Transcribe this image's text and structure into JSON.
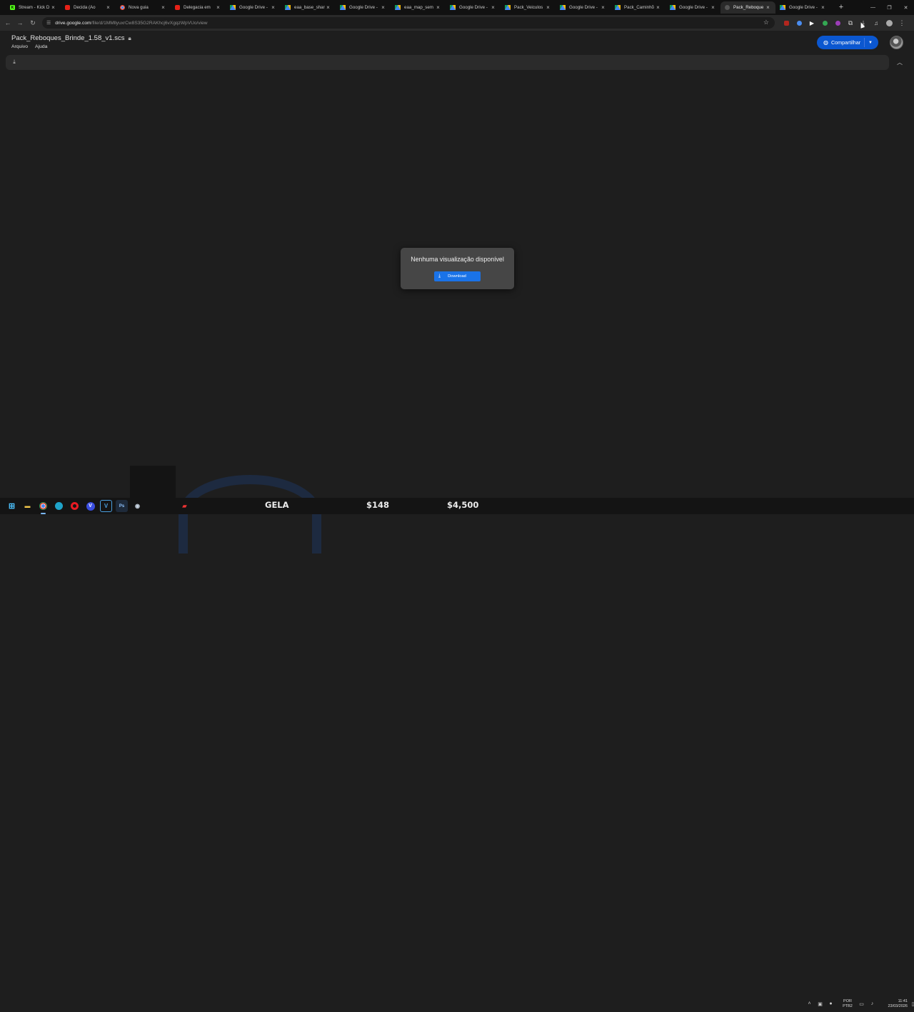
{
  "browser": {
    "tabs": [
      {
        "title": "Stream - Kick D",
        "favicon": "kick-icon",
        "active": false
      },
      {
        "title": "Decida (Ao",
        "favicon": "youtube-icon",
        "active": false
      },
      {
        "title": "Nova guia",
        "favicon": "chrome-icon",
        "active": false
      },
      {
        "title": "Delegacia em",
        "favicon": "youtube-icon",
        "active": false
      },
      {
        "title": "Google Drive -",
        "favicon": "drive-icon",
        "active": false
      },
      {
        "title": "eaa_base_share",
        "favicon": "drive-icon",
        "active": false
      },
      {
        "title": "Google Drive -",
        "favicon": "drive-icon",
        "active": false
      },
      {
        "title": "eaa_map_sem",
        "favicon": "drive-icon",
        "active": false
      },
      {
        "title": "Google Drive -",
        "favicon": "drive-icon",
        "active": false
      },
      {
        "title": "Pack_Veiculos",
        "favicon": "drive-icon",
        "active": false
      },
      {
        "title": "Google Drive -",
        "favicon": "drive-icon",
        "active": false
      },
      {
        "title": "Pack_Caminhõ",
        "favicon": "drive-icon",
        "active": false
      },
      {
        "title": "Google Drive -",
        "favicon": "drive-icon",
        "active": false
      },
      {
        "title": "Pack_Reboque",
        "favicon": "blank-icon",
        "active": true
      },
      {
        "title": "Google Drive -",
        "favicon": "drive-icon",
        "active": false
      }
    ],
    "url": {
      "host": "drive.google.com",
      "path": "/file/d/1MMllyuxrCw8S35G2RAKhcj6vXgqzWpVUo/view"
    }
  },
  "drive": {
    "file_title": "Pack_Reboques_Brinde_1.58_v1.scs",
    "menu": [
      "Arquivo",
      "Ajuda"
    ],
    "share_label": "Compartilhar",
    "no_preview": "Nenhuma visualização disponível",
    "download_label": "Download"
  },
  "hud": {
    "label_1": "GELA",
    "label_2": "$148",
    "label_3": "$4,500"
  },
  "taskbar": {
    "lang_1": "POR",
    "lang_2": "PTB2",
    "time": "11:41",
    "date": "23/03/2026"
  },
  "colors": {
    "accent": "#0b57d0",
    "download_button": "#1a73e8",
    "background": "#1e1e1e"
  }
}
